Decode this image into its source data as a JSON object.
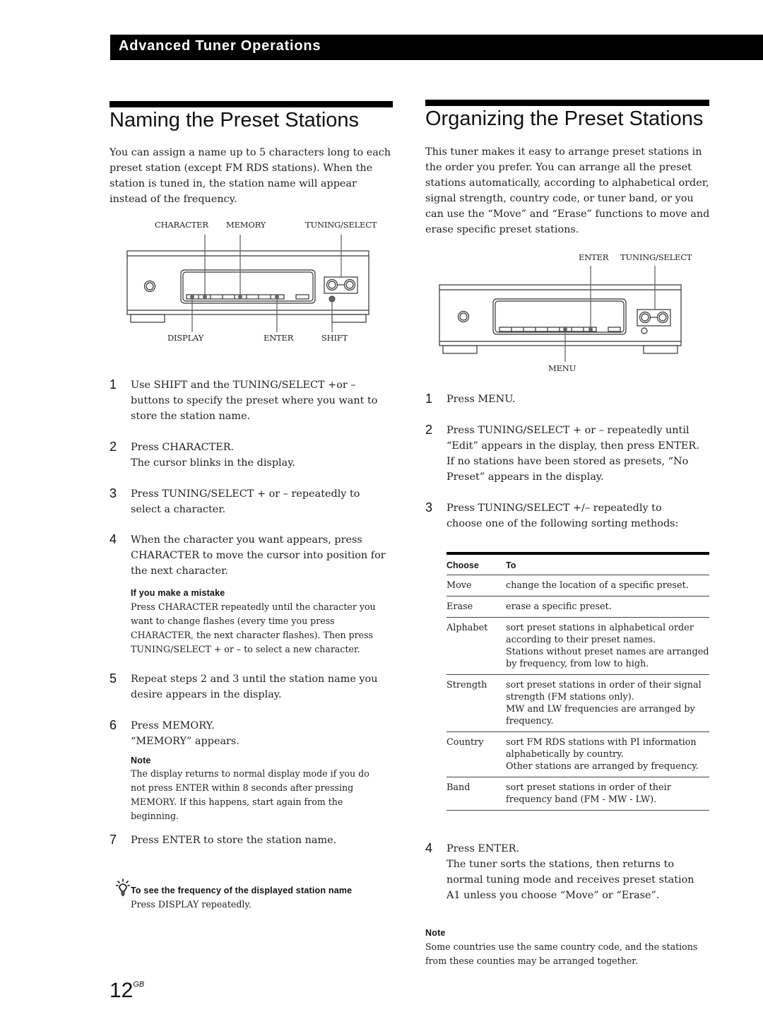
{
  "section_banner": "Advanced Tuner Operations",
  "left": {
    "title": "Naming the Preset Stations",
    "intro": "You can assign a name up to 5 characters long to each preset station (except FM RDS stations). When the station is tuned in, the station name will appear instead of the frequency.",
    "diagram_labels": {
      "character": "CHARACTER",
      "memory": "MEMORY",
      "tuning_select": "TUNING/SELECT",
      "display": "DISPLAY",
      "enter": "ENTER",
      "shift": "SHIFT"
    },
    "steps": [
      {
        "num": "1",
        "text": "Use  SHIFT and the TUNING/SELECT +or –\nbuttons to specify the preset where you want to\nstore the station name."
      },
      {
        "num": "2",
        "text": "Press CHARACTER.\nThe cursor blinks in the display."
      },
      {
        "num": "3",
        "text": "Press TUNING/SELECT + or – repeatedly to\nselect a character."
      },
      {
        "num": "4",
        "text": "When the character you want appears, press\nCHARACTER to move the cursor into position for\nthe next character."
      },
      {
        "num": "5",
        "text": "Repeat steps 2 and 3 until the station name you\ndesire appears in the display."
      },
      {
        "num": "6",
        "text": "Press MEMORY.\n“MEMORY” appears."
      },
      {
        "num": "7",
        "text": "Press ENTER to store the station name."
      }
    ],
    "mistake": {
      "heading": "If you make a mistake",
      "text": "Press CHARACTER repeatedly until the character you\nwant to change flashes (every time you press\nCHARACTER, the next character flashes). Then press\nTUNING/SELECT + or – to select a new character."
    },
    "note": {
      "heading": "Note",
      "text": "The display returns to normal display mode if you do\nnot press ENTER within 8 seconds after pressing\nMEMORY. If this happens, start again from the\nbeginning."
    },
    "tip": {
      "icon": "lightbulb-tip-icon",
      "heading": "To see the frequency of the displayed station name",
      "text": "Press DISPLAY repeatedly."
    }
  },
  "right": {
    "title": "Organizing the Preset Stations",
    "intro": "This tuner makes it easy to arrange preset stations in the order you prefer. You can arrange all the preset stations automatically, according to alphabetical order, signal strength, country code, or tuner band, or you can use the “Move” and “Erase” functions to move and erase specific preset stations.",
    "diagram_labels": {
      "enter": "ENTER",
      "tuning_select": "TUNING/SELECT",
      "menu": "MENU"
    },
    "steps": [
      {
        "num": "1",
        "text": "Press MENU."
      },
      {
        "num": "2",
        "text": "Press TUNING/SELECT + or – repeatedly until\n“Edit” appears in the display, then press ENTER.\nIf no stations have been stored as presets, “No\nPreset” appears in the display."
      },
      {
        "num": "3",
        "text": "Press TUNING/SELECT +/– repeatedly  to\nchoose one of the following sorting methods:"
      },
      {
        "num": "4",
        "text": "Press ENTER.\nThe tuner sorts the stations, then returns to\nnormal tuning mode and receives preset station\nA1 unless you choose “Move” or “Erase”."
      }
    ],
    "table": {
      "headers": [
        "Choose",
        "To"
      ],
      "rows": [
        {
          "choose": "Move",
          "to": [
            "change the location of a specific preset."
          ]
        },
        {
          "choose": "Erase",
          "to": [
            "erase a specific preset."
          ]
        },
        {
          "choose": "Alphabet",
          "to": [
            "sort preset stations in alphabetical order",
            "according to their preset names.",
            "Stations without preset names are arranged",
            "by frequency, from low to high."
          ]
        },
        {
          "choose": "Strength",
          "to": [
            "sort preset stations in order of their signal",
            "strength (FM stations only).",
            "MW and LW frequencies are arranged by",
            "frequency."
          ]
        },
        {
          "choose": "Country",
          "to": [
            "sort FM RDS stations with PI information",
            "alphabetically by country.",
            "Other stations are arranged by frequency."
          ]
        },
        {
          "choose": "Band",
          "to": [
            "sort preset stations in order of their",
            "frequency band (FM - MW - LW)."
          ]
        }
      ]
    },
    "note": {
      "heading": "Note",
      "text": "Some countries use the same country code, and the stations\nfrom these counties may be arranged together."
    }
  },
  "page_number": "12",
  "page_suffix": "GB"
}
